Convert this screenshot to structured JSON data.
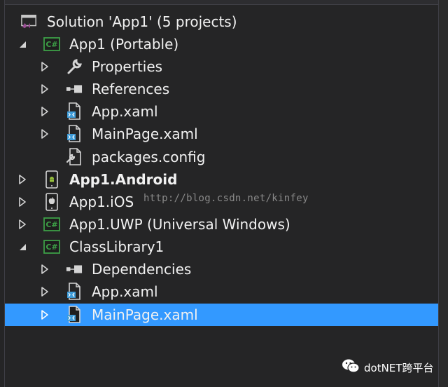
{
  "tree": {
    "items": [
      {
        "label": "Solution 'App1' (5 projects)",
        "icon": "vs-solution-icon",
        "expander": "none",
        "bold": false,
        "selected": false
      },
      {
        "label": "App1 (Portable)",
        "icon": "csharp-project-icon",
        "expander": "expanded",
        "bold": false,
        "selected": false
      },
      {
        "label": "Properties",
        "icon": "wrench-icon",
        "expander": "collapsed",
        "bold": false,
        "selected": false
      },
      {
        "label": "References",
        "icon": "references-icon",
        "expander": "collapsed",
        "bold": false,
        "selected": false
      },
      {
        "label": "App.xaml",
        "icon": "xaml-file-icon",
        "expander": "collapsed",
        "bold": false,
        "selected": false
      },
      {
        "label": "MainPage.xaml",
        "icon": "xaml-file-icon",
        "expander": "collapsed",
        "bold": false,
        "selected": false
      },
      {
        "label": "packages.config",
        "icon": "config-file-icon",
        "expander": "none",
        "bold": false,
        "selected": false
      },
      {
        "label": "App1.Android",
        "icon": "android-project-icon",
        "expander": "collapsed",
        "bold": true,
        "selected": false
      },
      {
        "label": "App1.iOS",
        "icon": "ios-project-icon",
        "expander": "collapsed",
        "bold": false,
        "selected": false
      },
      {
        "label": "App1.UWP (Universal Windows)",
        "icon": "csharp-project-icon",
        "expander": "collapsed",
        "bold": false,
        "selected": false
      },
      {
        "label": "ClassLibrary1",
        "icon": "csharp-project-icon",
        "expander": "expanded",
        "bold": false,
        "selected": false
      },
      {
        "label": "Dependencies",
        "icon": "references-icon",
        "expander": "collapsed",
        "bold": false,
        "selected": false
      },
      {
        "label": "App.xaml",
        "icon": "xaml-file-icon",
        "expander": "collapsed",
        "bold": false,
        "selected": false
      },
      {
        "label": "MainPage.xaml",
        "icon": "xaml-file-icon",
        "expander": "collapsed",
        "bold": false,
        "selected": true
      }
    ]
  },
  "watermark": "http://blog.csdn.net/kinfey",
  "wechat": {
    "text": "dotNET跨平台",
    "icon": "wechat-icon"
  },
  "colors": {
    "background": "#252526",
    "selection": "#3399ff",
    "csharp_green": "#3d9e47",
    "xaml_blue": "#3d9bd8",
    "vs_purple": "#9b4f96",
    "text": "#f1f1f1"
  }
}
